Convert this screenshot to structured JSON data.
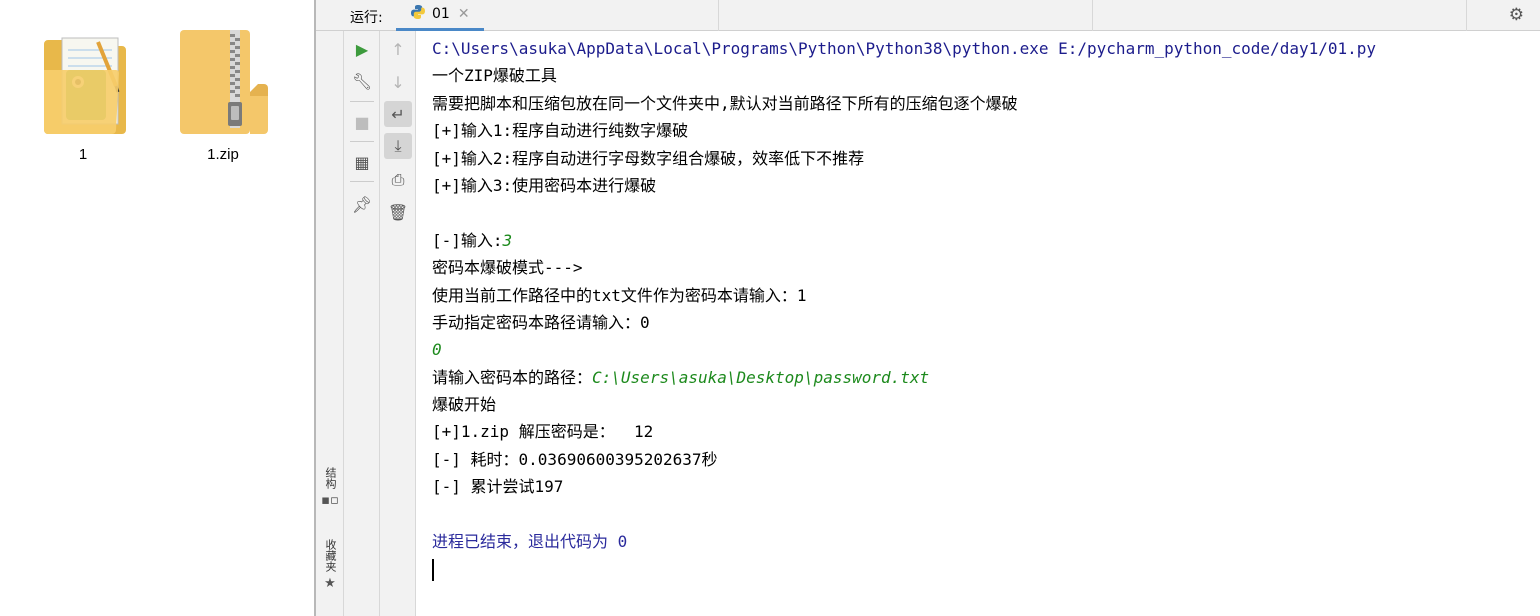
{
  "explorer": {
    "files": [
      {
        "name": "1",
        "type": "folder"
      },
      {
        "name": "1.zip",
        "type": "zip"
      }
    ]
  },
  "ide": {
    "run_label": "运行:",
    "tab_name": "01",
    "side_tabs": [
      {
        "label": "结构",
        "icon": "structure-icon"
      },
      {
        "label": "收藏夹",
        "icon": "star-icon"
      }
    ],
    "icons": {
      "settings": "gear-icon",
      "close": "close-icon",
      "python": "python-icon"
    },
    "colors": {
      "run_green": "#3d9b3d",
      "tab_underline": "#4a88c7",
      "console_input": "#1d8a1d",
      "console_system": "#2a2a9c"
    }
  },
  "console": {
    "command": "C:\\Users\\asuka\\AppData\\Local\\Programs\\Python\\Python38\\python.exe E:/pycharm_python_code/day1/01.py",
    "line_title": "一个ZIP爆破工具",
    "line_desc": "需要把脚本和压缩包放在同一个文件夹中,默认对当前路径下所有的压缩包逐个爆破",
    "opt1": "[+]输入1:程序自动进行纯数字爆破",
    "opt2": "[+]输入2:程序自动进行字母数字组合爆破，效率低下不推荐",
    "opt3": "[+]输入3:使用密码本进行爆破",
    "prompt_mode": "[-]输入:",
    "input_mode": "3",
    "mode_title": "密码本爆破模式--->",
    "sub_opt1": "使用当前工作路径中的txt文件作为密码本请输入：1",
    "sub_opt0": "手动指定密码本路径请输入：0",
    "input_sub": "0",
    "prompt_path": "请输入密码本的路径：",
    "input_path": "C:\\Users\\asuka\\Desktop\\password.txt",
    "start": "爆破开始",
    "result": "[+]1.zip 解压密码是：  12",
    "elapsed": "[-] 耗时：0.03690600395202637秒",
    "attempts": "[-] 累计尝试197",
    "exit_msg": "进程已结束，退出代码为 0"
  }
}
